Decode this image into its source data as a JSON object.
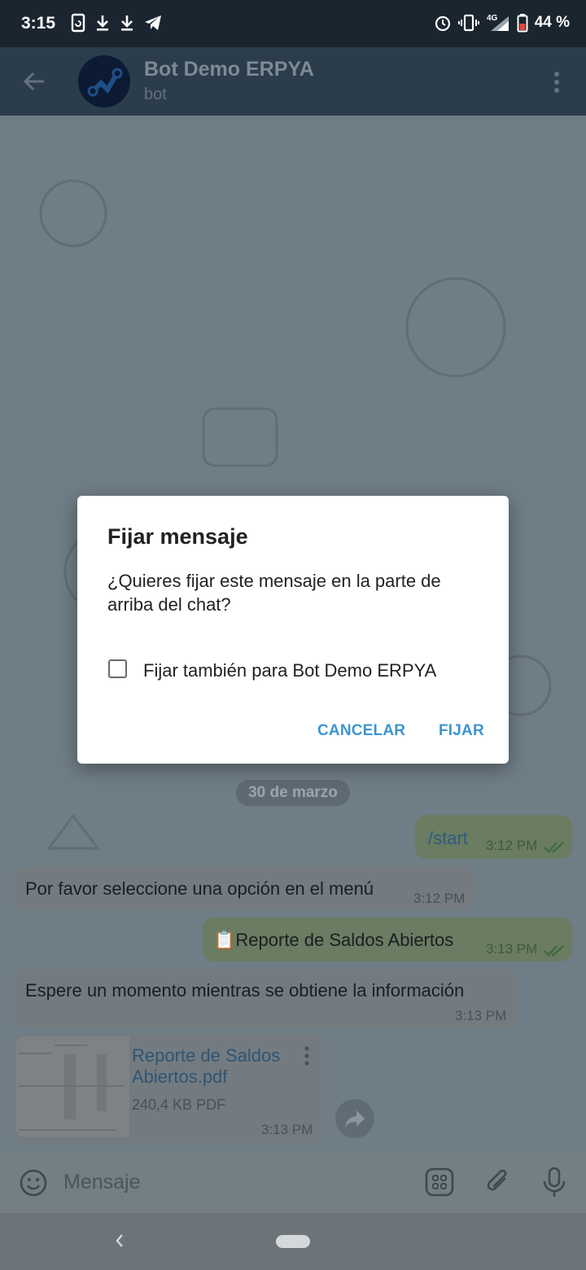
{
  "status_bar": {
    "time": "3:15",
    "battery": "44 %",
    "network": "4G",
    "left_icons": [
      "sync-icon",
      "download-icon",
      "download-icon",
      "telegram-icon"
    ],
    "right_icons": [
      "alarm-icon",
      "vibrate-icon",
      "signal-icon",
      "battery-icon"
    ]
  },
  "header": {
    "title": "Bot Demo ERPYA",
    "subtitle": "bot"
  },
  "chat": {
    "date": "30 de marzo",
    "messages": [
      {
        "text": "/start",
        "time": "3:12 PM",
        "direction": "out"
      },
      {
        "text": "Por favor seleccione una opción en el menú",
        "time": "3:12 PM",
        "direction": "in"
      },
      {
        "text": "📋Reporte de Saldos Abiertos",
        "time": "3:13 PM",
        "direction": "out"
      },
      {
        "text": "Espere un momento mientras se obtiene la información",
        "time": "3:13 PM",
        "direction": "in"
      }
    ],
    "document": {
      "name": "Reporte de Saldos Abiertos.pdf",
      "size": "240,4 KB PDF",
      "time": "3:13 PM"
    }
  },
  "input": {
    "placeholder": "Mensaje"
  },
  "dialog": {
    "title": "Fijar mensaje",
    "message": "¿Quieres fijar este mensaje en la parte de arriba del chat?",
    "checkbox_label": "Fijar también para Bot Demo ERPYA",
    "checkbox_checked": false,
    "cancel_label": "CANCELAR",
    "confirm_label": "FIJAR"
  },
  "colors": {
    "accent": "#3d95ce",
    "header_bg": "#2b3c4b",
    "status_bg": "#1a2530"
  }
}
